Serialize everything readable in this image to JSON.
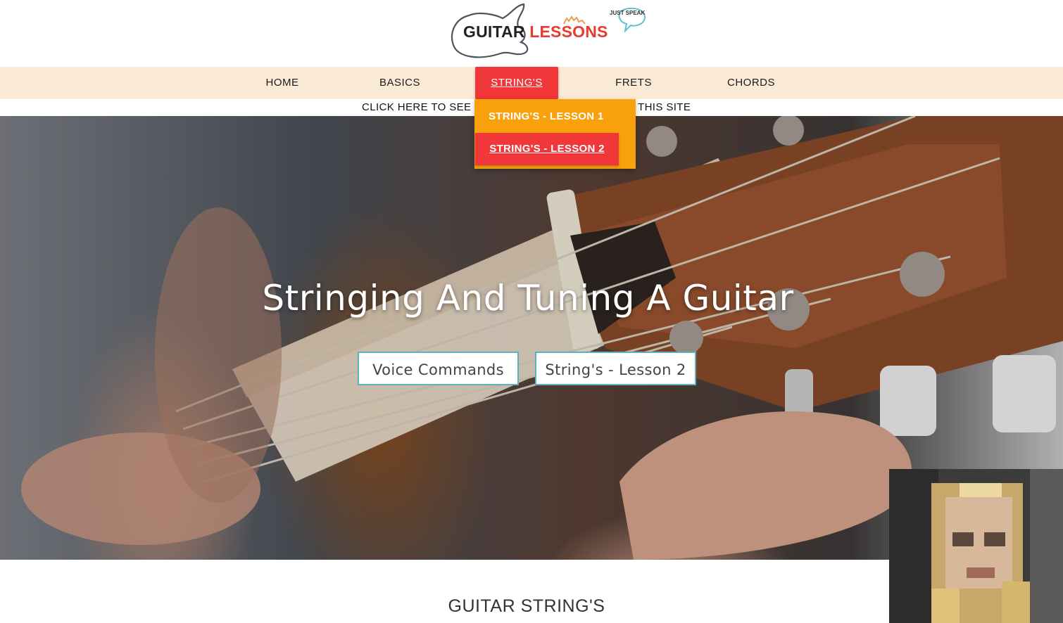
{
  "logo": {
    "word1": "GUITAR",
    "word2": "LESSONS",
    "badge": "JUST SPEAK"
  },
  "nav": {
    "items": [
      {
        "label": "HOME"
      },
      {
        "label": "BASICS"
      },
      {
        "label": "STRING'S",
        "active": true
      },
      {
        "label": "FRETS"
      },
      {
        "label": "CHORDS"
      }
    ]
  },
  "notice": {
    "left": "CLICK HERE TO SEE",
    "right": "THIS SITE"
  },
  "dropdown": {
    "items": [
      {
        "label": "STRING'S - LESSON 1"
      },
      {
        "label": "STRING'S - LESSON 2",
        "highlighted": true
      }
    ]
  },
  "hero": {
    "title": "Stringing And Tuning A Guitar",
    "buttons": [
      {
        "label": "Voice Commands"
      },
      {
        "label": "String's - Lesson 2"
      }
    ]
  },
  "section": {
    "title": "GUITAR STRING'S"
  },
  "colors": {
    "nav_bg": "#fbead6",
    "active_red": "#f2373a",
    "dropdown_orange": "#f9a10d",
    "button_border": "#5fb0bd"
  },
  "icons": [
    "guitar-outline-icon",
    "speech-bubble-icon"
  ]
}
